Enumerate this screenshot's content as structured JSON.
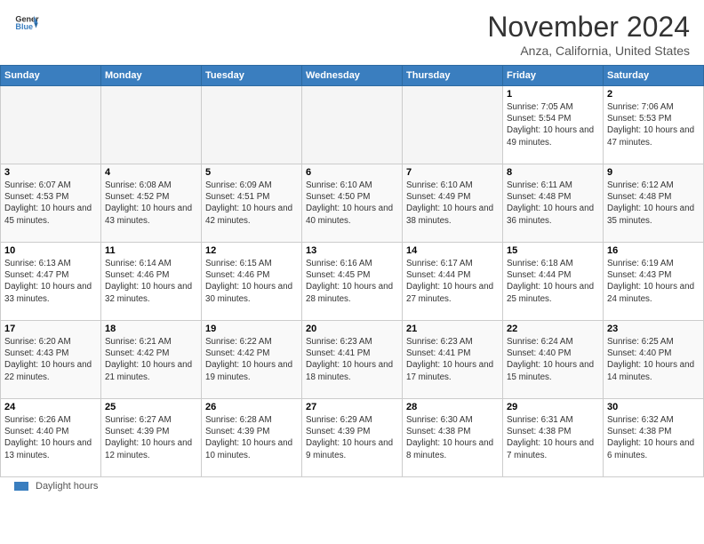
{
  "header": {
    "logo_general": "General",
    "logo_blue": "Blue",
    "month": "November 2024",
    "location": "Anza, California, United States"
  },
  "days_of_week": [
    "Sunday",
    "Monday",
    "Tuesday",
    "Wednesday",
    "Thursday",
    "Friday",
    "Saturday"
  ],
  "legend": {
    "label": "Daylight hours"
  },
  "weeks": [
    {
      "days": [
        {
          "num": "",
          "empty": true
        },
        {
          "num": "",
          "empty": true
        },
        {
          "num": "",
          "empty": true
        },
        {
          "num": "",
          "empty": true
        },
        {
          "num": "",
          "empty": true
        },
        {
          "num": "1",
          "sunrise": "7:05 AM",
          "sunset": "5:54 PM",
          "daylight": "10 hours and 49 minutes."
        },
        {
          "num": "2",
          "sunrise": "7:06 AM",
          "sunset": "5:53 PM",
          "daylight": "10 hours and 47 minutes."
        }
      ]
    },
    {
      "days": [
        {
          "num": "3",
          "sunrise": "6:07 AM",
          "sunset": "4:53 PM",
          "daylight": "10 hours and 45 minutes."
        },
        {
          "num": "4",
          "sunrise": "6:08 AM",
          "sunset": "4:52 PM",
          "daylight": "10 hours and 43 minutes."
        },
        {
          "num": "5",
          "sunrise": "6:09 AM",
          "sunset": "4:51 PM",
          "daylight": "10 hours and 42 minutes."
        },
        {
          "num": "6",
          "sunrise": "6:10 AM",
          "sunset": "4:50 PM",
          "daylight": "10 hours and 40 minutes."
        },
        {
          "num": "7",
          "sunrise": "6:10 AM",
          "sunset": "4:49 PM",
          "daylight": "10 hours and 38 minutes."
        },
        {
          "num": "8",
          "sunrise": "6:11 AM",
          "sunset": "4:48 PM",
          "daylight": "10 hours and 36 minutes."
        },
        {
          "num": "9",
          "sunrise": "6:12 AM",
          "sunset": "4:48 PM",
          "daylight": "10 hours and 35 minutes."
        }
      ]
    },
    {
      "days": [
        {
          "num": "10",
          "sunrise": "6:13 AM",
          "sunset": "4:47 PM",
          "daylight": "10 hours and 33 minutes."
        },
        {
          "num": "11",
          "sunrise": "6:14 AM",
          "sunset": "4:46 PM",
          "daylight": "10 hours and 32 minutes."
        },
        {
          "num": "12",
          "sunrise": "6:15 AM",
          "sunset": "4:46 PM",
          "daylight": "10 hours and 30 minutes."
        },
        {
          "num": "13",
          "sunrise": "6:16 AM",
          "sunset": "4:45 PM",
          "daylight": "10 hours and 28 minutes."
        },
        {
          "num": "14",
          "sunrise": "6:17 AM",
          "sunset": "4:44 PM",
          "daylight": "10 hours and 27 minutes."
        },
        {
          "num": "15",
          "sunrise": "6:18 AM",
          "sunset": "4:44 PM",
          "daylight": "10 hours and 25 minutes."
        },
        {
          "num": "16",
          "sunrise": "6:19 AM",
          "sunset": "4:43 PM",
          "daylight": "10 hours and 24 minutes."
        }
      ]
    },
    {
      "days": [
        {
          "num": "17",
          "sunrise": "6:20 AM",
          "sunset": "4:43 PM",
          "daylight": "10 hours and 22 minutes."
        },
        {
          "num": "18",
          "sunrise": "6:21 AM",
          "sunset": "4:42 PM",
          "daylight": "10 hours and 21 minutes."
        },
        {
          "num": "19",
          "sunrise": "6:22 AM",
          "sunset": "4:42 PM",
          "daylight": "10 hours and 19 minutes."
        },
        {
          "num": "20",
          "sunrise": "6:23 AM",
          "sunset": "4:41 PM",
          "daylight": "10 hours and 18 minutes."
        },
        {
          "num": "21",
          "sunrise": "6:23 AM",
          "sunset": "4:41 PM",
          "daylight": "10 hours and 17 minutes."
        },
        {
          "num": "22",
          "sunrise": "6:24 AM",
          "sunset": "4:40 PM",
          "daylight": "10 hours and 15 minutes."
        },
        {
          "num": "23",
          "sunrise": "6:25 AM",
          "sunset": "4:40 PM",
          "daylight": "10 hours and 14 minutes."
        }
      ]
    },
    {
      "days": [
        {
          "num": "24",
          "sunrise": "6:26 AM",
          "sunset": "4:40 PM",
          "daylight": "10 hours and 13 minutes."
        },
        {
          "num": "25",
          "sunrise": "6:27 AM",
          "sunset": "4:39 PM",
          "daylight": "10 hours and 12 minutes."
        },
        {
          "num": "26",
          "sunrise": "6:28 AM",
          "sunset": "4:39 PM",
          "daylight": "10 hours and 10 minutes."
        },
        {
          "num": "27",
          "sunrise": "6:29 AM",
          "sunset": "4:39 PM",
          "daylight": "10 hours and 9 minutes."
        },
        {
          "num": "28",
          "sunrise": "6:30 AM",
          "sunset": "4:38 PM",
          "daylight": "10 hours and 8 minutes."
        },
        {
          "num": "29",
          "sunrise": "6:31 AM",
          "sunset": "4:38 PM",
          "daylight": "10 hours and 7 minutes."
        },
        {
          "num": "30",
          "sunrise": "6:32 AM",
          "sunset": "4:38 PM",
          "daylight": "10 hours and 6 minutes."
        }
      ]
    }
  ]
}
